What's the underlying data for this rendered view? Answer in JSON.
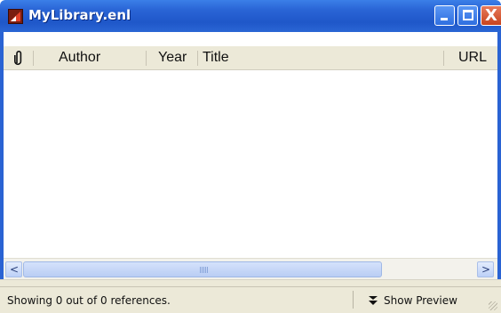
{
  "window": {
    "title": "MyLibrary.enl",
    "icon": "endnote-app-icon",
    "controls": {
      "minimize": "minimize-icon",
      "maximize": "maximize-icon",
      "close": "close-icon",
      "close_glyph": "X"
    }
  },
  "columns": {
    "attachment_icon": "paperclip-icon",
    "author": "Author",
    "year": "Year",
    "title": "Title",
    "url": "URL"
  },
  "list": {
    "rows": []
  },
  "scrollbar": {
    "left_arrow": "<",
    "right_arrow": ">",
    "left_icon": "chevron-left-icon",
    "right_icon": "chevron-right-icon"
  },
  "status": {
    "summary": "Showing 0 out of 0 references.",
    "preview_label": "Show Preview",
    "preview_icon": "double-chevron-down-icon"
  }
}
